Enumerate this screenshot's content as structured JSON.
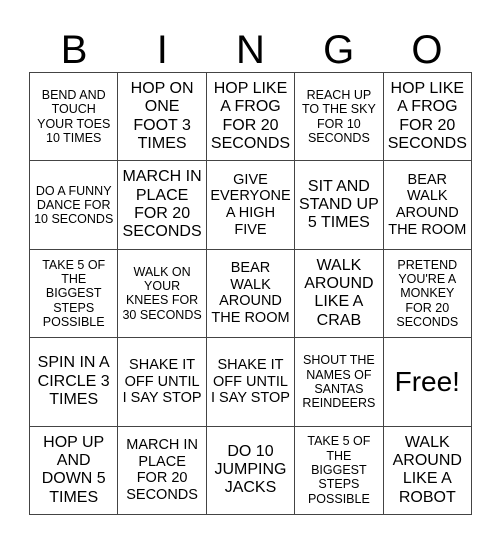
{
  "header": {
    "letters": [
      "B",
      "I",
      "N",
      "G",
      "O"
    ]
  },
  "card": {
    "rows": [
      [
        {
          "text": "BEND AND TOUCH YOUR TOES 10 TIMES",
          "size": "s"
        },
        {
          "text": "HOP ON ONE FOOT 3 TIMES",
          "size": "l"
        },
        {
          "text": "HOP LIKE A FROG FOR 20 SECONDS",
          "size": "l"
        },
        {
          "text": "REACH UP TO THE SKY FOR 10 SECONDS",
          "size": "s"
        },
        {
          "text": "HOP LIKE A FROG FOR 20 SECONDS",
          "size": "l"
        }
      ],
      [
        {
          "text": "DO A FUNNY DANCE FOR 10 SECONDS",
          "size": "s"
        },
        {
          "text": "MARCH IN PLACE FOR 20 SECONDS",
          "size": "l"
        },
        {
          "text": "GIVE EVERYONE A HIGH FIVE",
          "size": "m"
        },
        {
          "text": "SIT AND STAND UP 5 TIMES",
          "size": "l"
        },
        {
          "text": "BEAR WALK AROUND THE ROOM",
          "size": "m"
        }
      ],
      [
        {
          "text": "TAKE 5 OF THE BIGGEST STEPS POSSIBLE",
          "size": "s"
        },
        {
          "text": "WALK ON YOUR KNEES FOR 30 SECONDS",
          "size": "s"
        },
        {
          "text": "BEAR WALK AROUND THE ROOM",
          "size": "m"
        },
        {
          "text": "WALK AROUND LIKE A CRAB",
          "size": "l"
        },
        {
          "text": "PRETEND YOU'RE A MONKEY FOR 20 SECONDS",
          "size": "s"
        }
      ],
      [
        {
          "text": "SPIN IN A CIRCLE 3 TIMES",
          "size": "l"
        },
        {
          "text": "SHAKE IT OFF UNTIL I SAY STOP",
          "size": "m"
        },
        {
          "text": "SHAKE IT OFF UNTIL I SAY STOP",
          "size": "m"
        },
        {
          "text": "SHOUT THE NAMES OF SANTAS REINDEERS",
          "size": "s"
        },
        {
          "text": "Free!",
          "size": "free"
        }
      ],
      [
        {
          "text": "HOP UP AND DOWN 5 TIMES",
          "size": "l"
        },
        {
          "text": "MARCH IN PLACE FOR 20 SECONDS",
          "size": "m"
        },
        {
          "text": "DO 10 JUMPING JACKS",
          "size": "l"
        },
        {
          "text": "TAKE 5 OF THE BIGGEST STEPS POSSIBLE",
          "size": "s"
        },
        {
          "text": "WALK AROUND LIKE A ROBOT",
          "size": "l"
        }
      ]
    ]
  }
}
